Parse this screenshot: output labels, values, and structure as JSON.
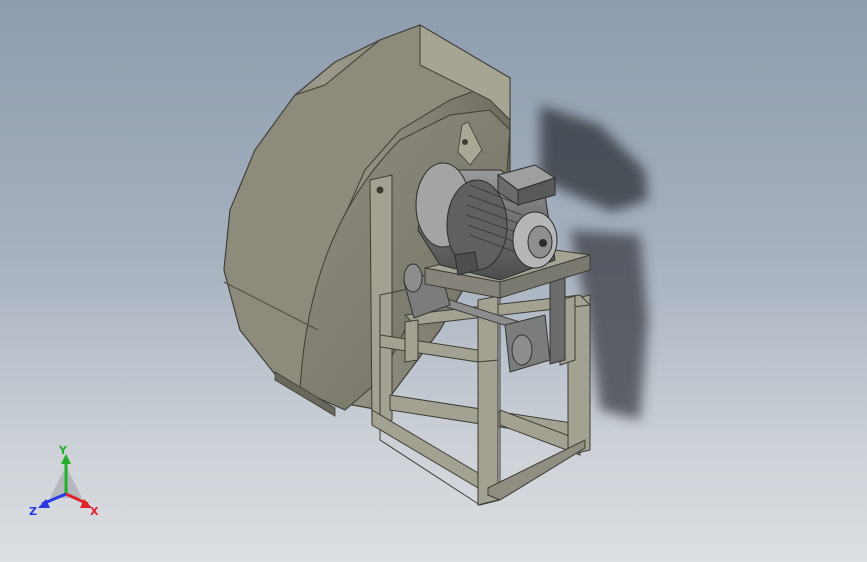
{
  "viewport": {
    "model": "centrifugal-fan-with-motor",
    "background_top": "#8e9cae",
    "background_bottom": "#dcdfe3"
  },
  "colors": {
    "housing": "#8a8877",
    "housing_dark": "#6e6c5f",
    "frame": "#9a9888",
    "motor": "#7c7e7e",
    "shadow": "#3a3e44"
  },
  "triad": {
    "x_label": "X",
    "y_label": "Y",
    "z_label": "Z",
    "x_color": "#e0222a",
    "y_color": "#22b02a",
    "z_color": "#2a3ae0"
  }
}
